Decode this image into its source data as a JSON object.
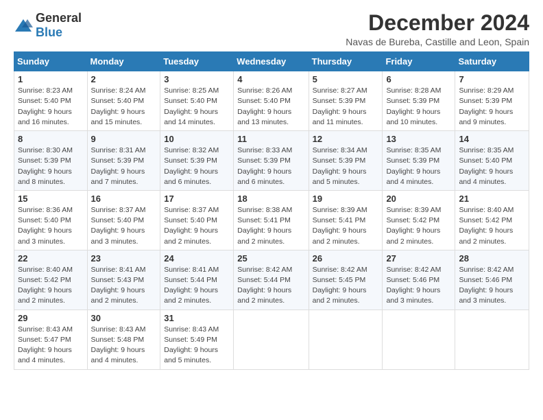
{
  "logo": {
    "general": "General",
    "blue": "Blue"
  },
  "title": "December 2024",
  "location": "Navas de Bureba, Castille and Leon, Spain",
  "days_header": [
    "Sunday",
    "Monday",
    "Tuesday",
    "Wednesday",
    "Thursday",
    "Friday",
    "Saturday"
  ],
  "weeks": [
    [
      {
        "day": "1",
        "sunrise": "8:23 AM",
        "sunset": "5:40 PM",
        "daylight": "9 hours and 16 minutes."
      },
      {
        "day": "2",
        "sunrise": "8:24 AM",
        "sunset": "5:40 PM",
        "daylight": "9 hours and 15 minutes."
      },
      {
        "day": "3",
        "sunrise": "8:25 AM",
        "sunset": "5:40 PM",
        "daylight": "9 hours and 14 minutes."
      },
      {
        "day": "4",
        "sunrise": "8:26 AM",
        "sunset": "5:40 PM",
        "daylight": "9 hours and 13 minutes."
      },
      {
        "day": "5",
        "sunrise": "8:27 AM",
        "sunset": "5:39 PM",
        "daylight": "9 hours and 11 minutes."
      },
      {
        "day": "6",
        "sunrise": "8:28 AM",
        "sunset": "5:39 PM",
        "daylight": "9 hours and 10 minutes."
      },
      {
        "day": "7",
        "sunrise": "8:29 AM",
        "sunset": "5:39 PM",
        "daylight": "9 hours and 9 minutes."
      }
    ],
    [
      {
        "day": "8",
        "sunrise": "8:30 AM",
        "sunset": "5:39 PM",
        "daylight": "9 hours and 8 minutes."
      },
      {
        "day": "9",
        "sunrise": "8:31 AM",
        "sunset": "5:39 PM",
        "daylight": "9 hours and 7 minutes."
      },
      {
        "day": "10",
        "sunrise": "8:32 AM",
        "sunset": "5:39 PM",
        "daylight": "9 hours and 6 minutes."
      },
      {
        "day": "11",
        "sunrise": "8:33 AM",
        "sunset": "5:39 PM",
        "daylight": "9 hours and 6 minutes."
      },
      {
        "day": "12",
        "sunrise": "8:34 AM",
        "sunset": "5:39 PM",
        "daylight": "9 hours and 5 minutes."
      },
      {
        "day": "13",
        "sunrise": "8:35 AM",
        "sunset": "5:39 PM",
        "daylight": "9 hours and 4 minutes."
      },
      {
        "day": "14",
        "sunrise": "8:35 AM",
        "sunset": "5:40 PM",
        "daylight": "9 hours and 4 minutes."
      }
    ],
    [
      {
        "day": "15",
        "sunrise": "8:36 AM",
        "sunset": "5:40 PM",
        "daylight": "9 hours and 3 minutes."
      },
      {
        "day": "16",
        "sunrise": "8:37 AM",
        "sunset": "5:40 PM",
        "daylight": "9 hours and 3 minutes."
      },
      {
        "day": "17",
        "sunrise": "8:37 AM",
        "sunset": "5:40 PM",
        "daylight": "9 hours and 2 minutes."
      },
      {
        "day": "18",
        "sunrise": "8:38 AM",
        "sunset": "5:41 PM",
        "daylight": "9 hours and 2 minutes."
      },
      {
        "day": "19",
        "sunrise": "8:39 AM",
        "sunset": "5:41 PM",
        "daylight": "9 hours and 2 minutes."
      },
      {
        "day": "20",
        "sunrise": "8:39 AM",
        "sunset": "5:42 PM",
        "daylight": "9 hours and 2 minutes."
      },
      {
        "day": "21",
        "sunrise": "8:40 AM",
        "sunset": "5:42 PM",
        "daylight": "9 hours and 2 minutes."
      }
    ],
    [
      {
        "day": "22",
        "sunrise": "8:40 AM",
        "sunset": "5:42 PM",
        "daylight": "9 hours and 2 minutes."
      },
      {
        "day": "23",
        "sunrise": "8:41 AM",
        "sunset": "5:43 PM",
        "daylight": "9 hours and 2 minutes."
      },
      {
        "day": "24",
        "sunrise": "8:41 AM",
        "sunset": "5:44 PM",
        "daylight": "9 hours and 2 minutes."
      },
      {
        "day": "25",
        "sunrise": "8:42 AM",
        "sunset": "5:44 PM",
        "daylight": "9 hours and 2 minutes."
      },
      {
        "day": "26",
        "sunrise": "8:42 AM",
        "sunset": "5:45 PM",
        "daylight": "9 hours and 2 minutes."
      },
      {
        "day": "27",
        "sunrise": "8:42 AM",
        "sunset": "5:46 PM",
        "daylight": "9 hours and 3 minutes."
      },
      {
        "day": "28",
        "sunrise": "8:42 AM",
        "sunset": "5:46 PM",
        "daylight": "9 hours and 3 minutes."
      }
    ],
    [
      {
        "day": "29",
        "sunrise": "8:43 AM",
        "sunset": "5:47 PM",
        "daylight": "9 hours and 4 minutes."
      },
      {
        "day": "30",
        "sunrise": "8:43 AM",
        "sunset": "5:48 PM",
        "daylight": "9 hours and 4 minutes."
      },
      {
        "day": "31",
        "sunrise": "8:43 AM",
        "sunset": "5:49 PM",
        "daylight": "9 hours and 5 minutes."
      },
      null,
      null,
      null,
      null
    ]
  ],
  "labels": {
    "sunrise": "Sunrise:",
    "sunset": "Sunset:",
    "daylight": "Daylight:"
  }
}
